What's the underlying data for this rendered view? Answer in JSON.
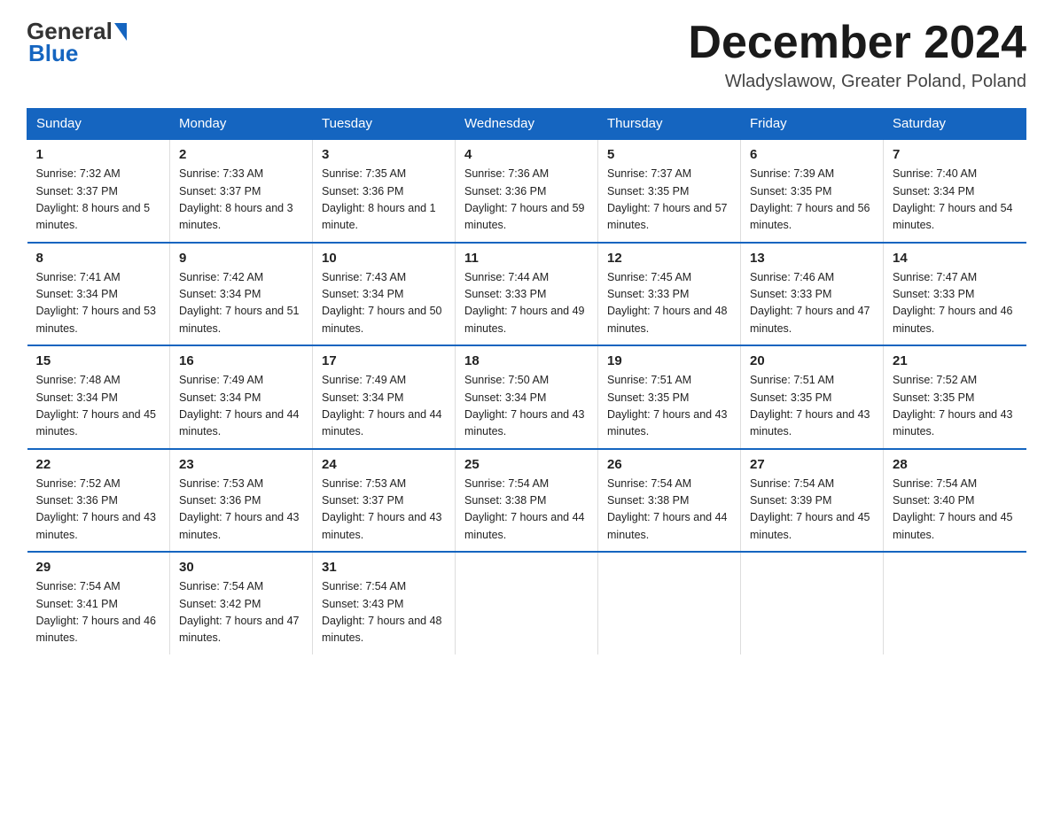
{
  "header": {
    "month_title": "December 2024",
    "location": "Wladyslawow, Greater Poland, Poland",
    "logo_general": "General",
    "logo_blue": "Blue"
  },
  "days_of_week": [
    "Sunday",
    "Monday",
    "Tuesday",
    "Wednesday",
    "Thursday",
    "Friday",
    "Saturday"
  ],
  "weeks": [
    [
      {
        "day": "1",
        "sunrise": "7:32 AM",
        "sunset": "3:37 PM",
        "daylight": "8 hours and 5 minutes."
      },
      {
        "day": "2",
        "sunrise": "7:33 AM",
        "sunset": "3:37 PM",
        "daylight": "8 hours and 3 minutes."
      },
      {
        "day": "3",
        "sunrise": "7:35 AM",
        "sunset": "3:36 PM",
        "daylight": "8 hours and 1 minute."
      },
      {
        "day": "4",
        "sunrise": "7:36 AM",
        "sunset": "3:36 PM",
        "daylight": "7 hours and 59 minutes."
      },
      {
        "day": "5",
        "sunrise": "7:37 AM",
        "sunset": "3:35 PM",
        "daylight": "7 hours and 57 minutes."
      },
      {
        "day": "6",
        "sunrise": "7:39 AM",
        "sunset": "3:35 PM",
        "daylight": "7 hours and 56 minutes."
      },
      {
        "day": "7",
        "sunrise": "7:40 AM",
        "sunset": "3:34 PM",
        "daylight": "7 hours and 54 minutes."
      }
    ],
    [
      {
        "day": "8",
        "sunrise": "7:41 AM",
        "sunset": "3:34 PM",
        "daylight": "7 hours and 53 minutes."
      },
      {
        "day": "9",
        "sunrise": "7:42 AM",
        "sunset": "3:34 PM",
        "daylight": "7 hours and 51 minutes."
      },
      {
        "day": "10",
        "sunrise": "7:43 AM",
        "sunset": "3:34 PM",
        "daylight": "7 hours and 50 minutes."
      },
      {
        "day": "11",
        "sunrise": "7:44 AM",
        "sunset": "3:33 PM",
        "daylight": "7 hours and 49 minutes."
      },
      {
        "day": "12",
        "sunrise": "7:45 AM",
        "sunset": "3:33 PM",
        "daylight": "7 hours and 48 minutes."
      },
      {
        "day": "13",
        "sunrise": "7:46 AM",
        "sunset": "3:33 PM",
        "daylight": "7 hours and 47 minutes."
      },
      {
        "day": "14",
        "sunrise": "7:47 AM",
        "sunset": "3:33 PM",
        "daylight": "7 hours and 46 minutes."
      }
    ],
    [
      {
        "day": "15",
        "sunrise": "7:48 AM",
        "sunset": "3:34 PM",
        "daylight": "7 hours and 45 minutes."
      },
      {
        "day": "16",
        "sunrise": "7:49 AM",
        "sunset": "3:34 PM",
        "daylight": "7 hours and 44 minutes."
      },
      {
        "day": "17",
        "sunrise": "7:49 AM",
        "sunset": "3:34 PM",
        "daylight": "7 hours and 44 minutes."
      },
      {
        "day": "18",
        "sunrise": "7:50 AM",
        "sunset": "3:34 PM",
        "daylight": "7 hours and 43 minutes."
      },
      {
        "day": "19",
        "sunrise": "7:51 AM",
        "sunset": "3:35 PM",
        "daylight": "7 hours and 43 minutes."
      },
      {
        "day": "20",
        "sunrise": "7:51 AM",
        "sunset": "3:35 PM",
        "daylight": "7 hours and 43 minutes."
      },
      {
        "day": "21",
        "sunrise": "7:52 AM",
        "sunset": "3:35 PM",
        "daylight": "7 hours and 43 minutes."
      }
    ],
    [
      {
        "day": "22",
        "sunrise": "7:52 AM",
        "sunset": "3:36 PM",
        "daylight": "7 hours and 43 minutes."
      },
      {
        "day": "23",
        "sunrise": "7:53 AM",
        "sunset": "3:36 PM",
        "daylight": "7 hours and 43 minutes."
      },
      {
        "day": "24",
        "sunrise": "7:53 AM",
        "sunset": "3:37 PM",
        "daylight": "7 hours and 43 minutes."
      },
      {
        "day": "25",
        "sunrise": "7:54 AM",
        "sunset": "3:38 PM",
        "daylight": "7 hours and 44 minutes."
      },
      {
        "day": "26",
        "sunrise": "7:54 AM",
        "sunset": "3:38 PM",
        "daylight": "7 hours and 44 minutes."
      },
      {
        "day": "27",
        "sunrise": "7:54 AM",
        "sunset": "3:39 PM",
        "daylight": "7 hours and 45 minutes."
      },
      {
        "day": "28",
        "sunrise": "7:54 AM",
        "sunset": "3:40 PM",
        "daylight": "7 hours and 45 minutes."
      }
    ],
    [
      {
        "day": "29",
        "sunrise": "7:54 AM",
        "sunset": "3:41 PM",
        "daylight": "7 hours and 46 minutes."
      },
      {
        "day": "30",
        "sunrise": "7:54 AM",
        "sunset": "3:42 PM",
        "daylight": "7 hours and 47 minutes."
      },
      {
        "day": "31",
        "sunrise": "7:54 AM",
        "sunset": "3:43 PM",
        "daylight": "7 hours and 48 minutes."
      },
      null,
      null,
      null,
      null
    ]
  ]
}
